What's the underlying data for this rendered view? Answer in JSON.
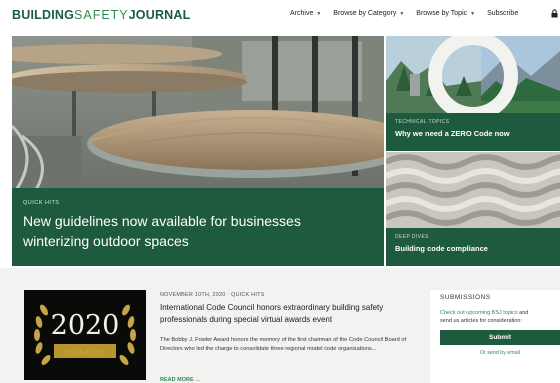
{
  "header": {
    "logo": {
      "part1": "BUILDING",
      "part2": "SAFETY",
      "part3": "JOURNAL"
    },
    "nav": [
      {
        "label": "Archive",
        "dropdown": true
      },
      {
        "label": "Browse by Category",
        "dropdown": true
      },
      {
        "label": "Browse by Topic",
        "dropdown": true
      },
      {
        "label": "Subscribe",
        "dropdown": false
      }
    ],
    "icon": "lock-icon"
  },
  "hero": {
    "tag": "QUICK HITS",
    "title": "New guidelines now available for businesses winterizing outdoor spaces"
  },
  "cards": [
    {
      "tag": "TECHNICAL TOPICS",
      "title": "Why we need a ZERO Code now"
    },
    {
      "tag": "DEEP DIVES",
      "title": "Building code compliance"
    }
  ],
  "feature": {
    "thumb": {
      "year": "2020",
      "label": "AWARDS"
    },
    "meta": "NOVEMBER 10TH, 2020 · QUICK HITS",
    "title": "International Code Council honors extraordinary building safety professionals during special virtual awards event",
    "excerpt": "The Bobby J. Fowler Award honors the memory of the first chairman of the Code Council Board of Directors who led the charge to consolidate three regional model code organizations...",
    "read_more": "READ MORE →"
  },
  "submissions": {
    "heading": "SUBMISSIONS",
    "line1_link": "Check out upcoming BSJ topics",
    "line1_rest": " and",
    "line2": "send us articles for consideration:",
    "button": "Submit",
    "email": "Or send by email"
  },
  "colors": {
    "brand_green": "#1e5a3d",
    "accent_green": "#2f8b55"
  }
}
